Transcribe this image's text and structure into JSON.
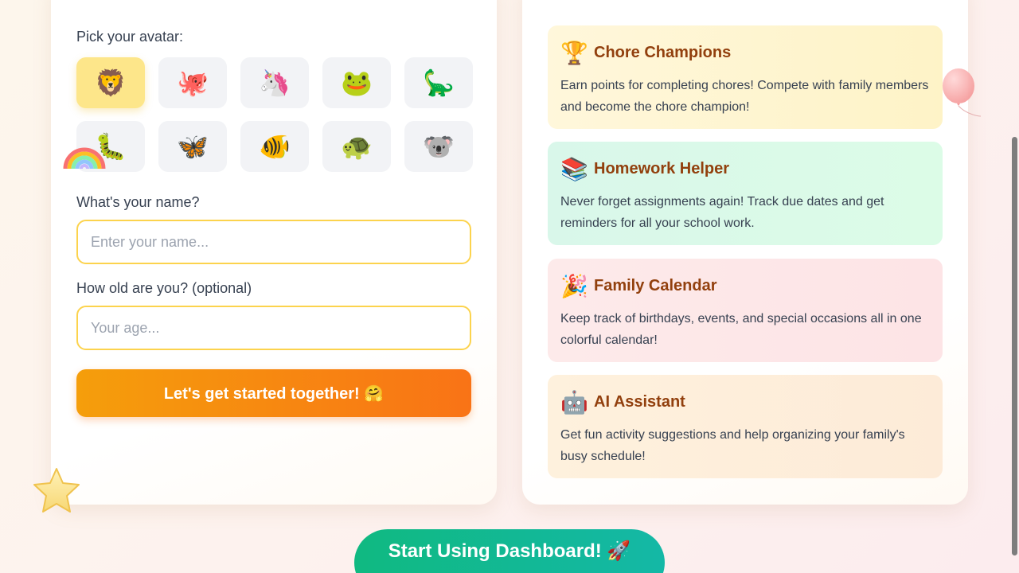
{
  "profile_form": {
    "avatar_label": "Pick your avatar:",
    "avatars": [
      {
        "emoji": "🦁",
        "name": "lion",
        "selected": true
      },
      {
        "emoji": "🐙",
        "name": "octopus",
        "selected": false
      },
      {
        "emoji": "🦄",
        "name": "unicorn",
        "selected": false
      },
      {
        "emoji": "🐸",
        "name": "frog",
        "selected": false
      },
      {
        "emoji": "🦕",
        "name": "dinosaur",
        "selected": false
      },
      {
        "emoji": "🐛",
        "name": "caterpillar",
        "selected": false
      },
      {
        "emoji": "🦋",
        "name": "butterfly",
        "selected": false
      },
      {
        "emoji": "🐠",
        "name": "fish",
        "selected": false
      },
      {
        "emoji": "🐢",
        "name": "turtle",
        "selected": false
      },
      {
        "emoji": "🐨",
        "name": "koala",
        "selected": false
      }
    ],
    "name_label": "What's your name?",
    "name_placeholder": "Enter your name...",
    "name_value": "",
    "age_label": "How old are you? (optional)",
    "age_placeholder": "Your age...",
    "age_value": "",
    "submit_label": "Let's get started together! 🤗"
  },
  "features": [
    {
      "icon": "🏆",
      "icon_name": "trophy-icon",
      "title": "Chore Champions",
      "description": "Earn points for completing chores! Compete with family members and become the chore champion!"
    },
    {
      "icon": "📚",
      "icon_name": "books-icon",
      "title": "Homework Helper",
      "description": "Never forget assignments again! Track due dates and get reminders for all your school work."
    },
    {
      "icon": "🎉",
      "icon_name": "party-popper-icon",
      "title": "Family Calendar",
      "description": "Keep track of birthdays, events, and special occasions all in one colorful calendar!"
    },
    {
      "icon": "🤖",
      "icon_name": "robot-icon",
      "title": "AI Assistant",
      "description": "Get fun activity suggestions and help organizing your family's busy schedule!"
    }
  ],
  "dashboard_button": {
    "label": "Start Using Dashboard! 🚀"
  },
  "decorations": {
    "star": "star-icon",
    "rainbow": "rainbow-icon",
    "balloon": "balloon-icon"
  },
  "colors": {
    "accent_orange": "#f97316",
    "accent_teal": "#14b8a6",
    "input_border": "#fcd34d",
    "feature_title": "#92400e"
  }
}
